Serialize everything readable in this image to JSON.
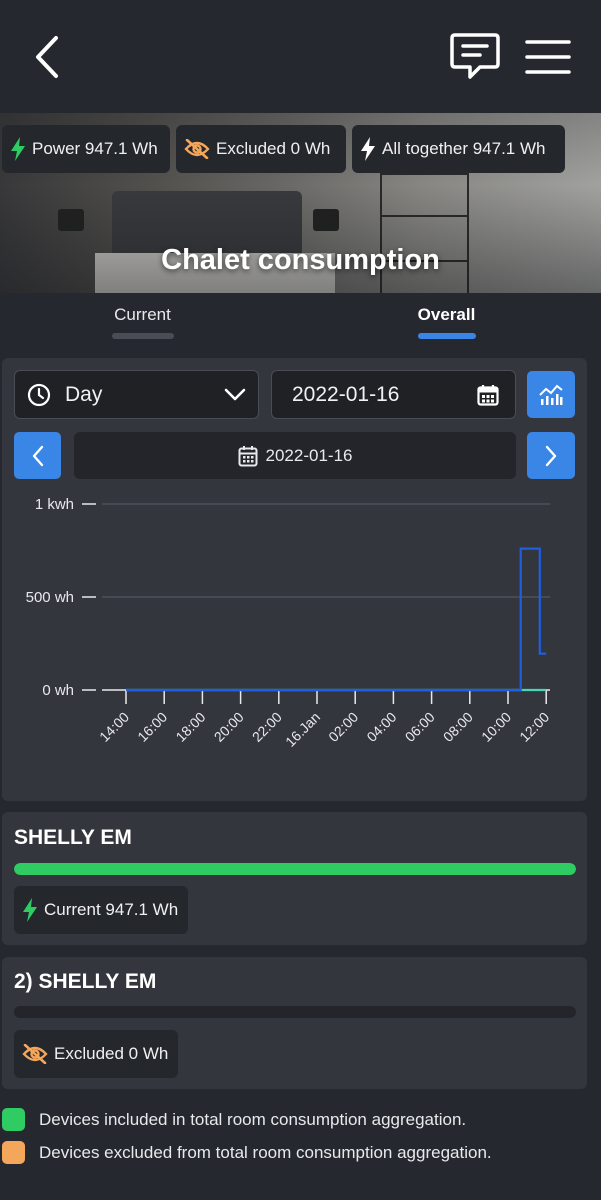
{
  "header": {
    "back_icon": "chevron-left-icon",
    "feedback_icon": "message-icon",
    "menu_icon": "hamburger-menu-icon"
  },
  "hero": {
    "title": "Chalet consumption",
    "chips": [
      {
        "icon": "lightning-icon",
        "color": "#2fcb63",
        "label": "Power 947.1 Wh"
      },
      {
        "icon": "eye-off-icon",
        "color": "#f4a65a",
        "label": "Excluded 0 Wh"
      },
      {
        "icon": "lightning-icon",
        "color": "#ffffff",
        "label": "All together 947.1 Wh"
      }
    ]
  },
  "tabs": [
    {
      "label": "Current",
      "active": false
    },
    {
      "label": "Overall",
      "active": true
    }
  ],
  "controls": {
    "period_icon": "clock-icon",
    "period_value": "Day",
    "date_value": "2022-01-16",
    "date_icon": "calendar-icon",
    "chart_toggle_icon": "chart-icon",
    "prev_icon": "chevron-left-icon",
    "next_icon": "chevron-right-icon",
    "current_date": "2022-01-16"
  },
  "chart_data": {
    "type": "line",
    "y_ticks": [
      "1 kwh",
      "500 wh",
      "0 wh"
    ],
    "y_tick_values": [
      1000,
      500,
      0
    ],
    "ylim": [
      0,
      1000
    ],
    "x_ticks": [
      "14:00",
      "16:00",
      "18:00",
      "20:00",
      "22:00",
      "16.Jan",
      "02:00",
      "04:00",
      "06:00",
      "08:00",
      "10:00",
      "12:00"
    ],
    "series": [
      {
        "color": "#1f5fe0",
        "x": [
          "14:00",
          "10:40",
          "10:40",
          "11:40",
          "11:40",
          "12:00"
        ],
        "values": [
          0,
          0,
          760,
          760,
          195,
          195
        ]
      },
      {
        "color": "#48d6b4",
        "x": [
          "14:00",
          "12:00"
        ],
        "values": [
          0,
          0
        ]
      }
    ],
    "grid": true
  },
  "devices": [
    {
      "name": "SHELLY EM",
      "fill_fraction": 1.0,
      "badge_icon": "lightning-icon",
      "badge_color": "#2fcb63",
      "badge": "Current 947.1 Wh"
    },
    {
      "name": "2) SHELLY EM",
      "fill_fraction": 0.0,
      "badge_icon": "eye-off-icon",
      "badge_color": "#f4a65a",
      "badge": "Excluded 0 Wh"
    }
  ],
  "legend": [
    {
      "color": "#2fcb63",
      "label": "Devices included in total room consumption aggregation."
    },
    {
      "color": "#f4a65a",
      "label": "Devices excluded from total room consumption aggregation."
    }
  ]
}
